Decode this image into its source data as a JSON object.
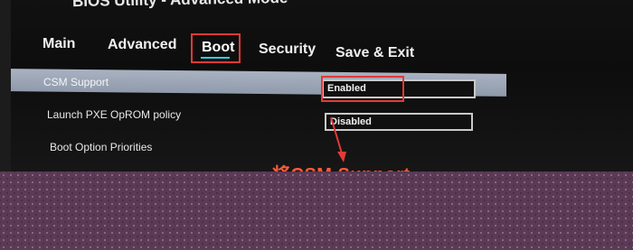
{
  "window": {
    "title_fragment": "BIOS Utility - Advanced Mode"
  },
  "tabs": [
    {
      "label": "Main"
    },
    {
      "label": "Advanced"
    },
    {
      "label": "Boot",
      "selected": true
    },
    {
      "label": "Security"
    },
    {
      "label": "Save & Exit"
    }
  ],
  "settings": [
    {
      "label": "CSM Support",
      "value": "Enabled",
      "highlighted": true
    },
    {
      "label": "Launch PXE OpROM policy",
      "value": "Disabled"
    },
    {
      "label": "Boot Option Priorities"
    }
  ],
  "annotation": {
    "text": "将CSM Support",
    "color": "#ff5a3c"
  },
  "colors": {
    "accent_underline": "#2ad0e8",
    "annotation_box": "#e23a36",
    "highlight_row": "#a9b2c1"
  }
}
